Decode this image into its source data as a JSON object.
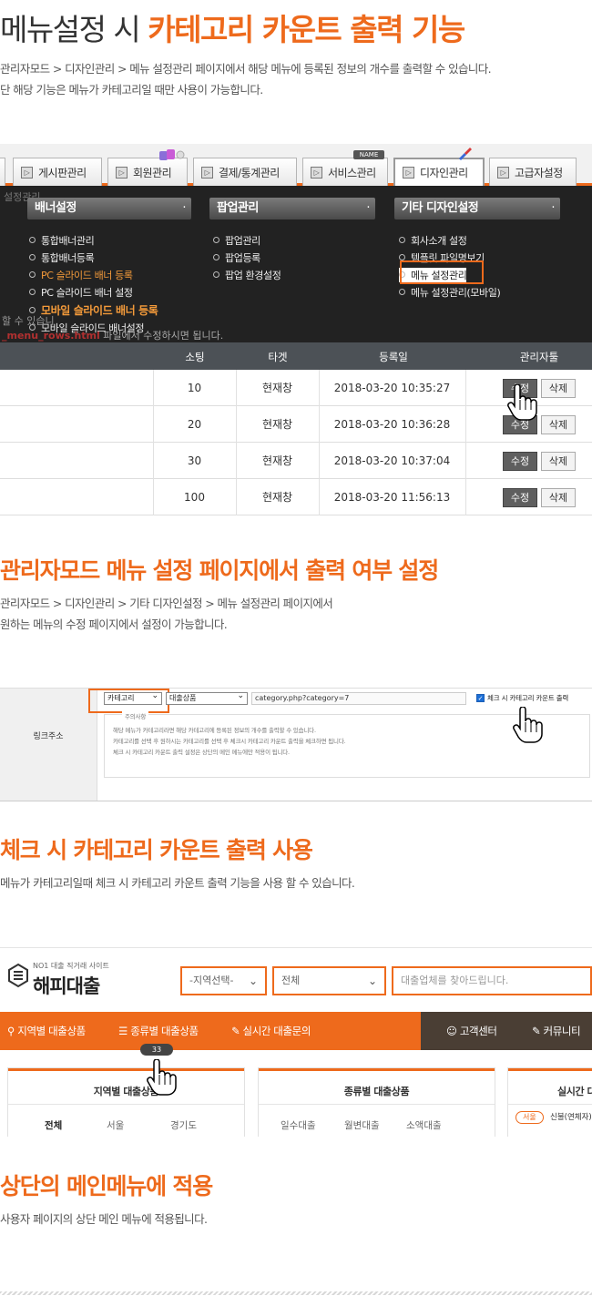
{
  "title": {
    "prefix": "메뉴설정 시 ",
    "highlight": "카테고리 카운트 출력 기능"
  },
  "intro": {
    "line1": "관리자모드 > 디자인관리 > 메뉴 설정관리 페이지에서 해당 메뉴에 등록된 정보의 개수를 출력할 수 있습니다.",
    "line2": "단 해당 기능은 메뉴가 카테고리일 때만 사용이 가능합니다."
  },
  "admin": {
    "tabs": [
      {
        "label": "게시판관리",
        "active": false
      },
      {
        "label": "회원관리",
        "active": false
      },
      {
        "label": "결제/통계관리",
        "active": false
      },
      {
        "label": "서비스관리",
        "active": false
      },
      {
        "label": "디자인관리",
        "active": true
      },
      {
        "label": "고급자설정",
        "active": false
      }
    ],
    "tab_badge": "NAME",
    "groups": [
      {
        "title": "배너설정",
        "dot": "·",
        "items": [
          "통합배너관리",
          "통합배너등록",
          "PC 슬라이드 배너 등록",
          "PC 슬라이드 배너 설정",
          "모바일 슬라이드 배너 등록",
          "모바일 슬라이드 배너설정"
        ]
      },
      {
        "title": "팝업관리",
        "dot": "·",
        "items": [
          "팝업관리",
          "팝업등록",
          "팝업 환경설정"
        ]
      },
      {
        "title": "기타 디자인설정",
        "dot": "·",
        "items": [
          "회사소개 설정",
          "템플릿 파일명보기",
          "메뉴 설정관리",
          "메뉴 설정관리(모바일)"
        ]
      }
    ],
    "ghost_left_top": "설정관리",
    "ghost_bottom_a": "할 수 있습니",
    "ghost_bottom_file": "_menu_rows.html",
    "ghost_bottom_b": " 파일에서 수정하시면 됩니다.",
    "table_headers": [
      "소팅",
      "타겟",
      "등록일",
      "관리자툴"
    ],
    "rows": [
      {
        "sort": "10",
        "target": "현재창",
        "date": "2018-03-20 10:35:27"
      },
      {
        "sort": "20",
        "target": "현재창",
        "date": "2018-03-20 10:36:28"
      },
      {
        "sort": "30",
        "target": "현재창",
        "date": "2018-03-20 10:37:04"
      },
      {
        "sort": "100",
        "target": "현재창",
        "date": "2018-03-20 11:56:13"
      }
    ],
    "edit_label": "수정",
    "delete_label": "삭제"
  },
  "section2": {
    "title": "관리자모드  메뉴 설정 페이지에서 출력 여부 설정",
    "line1": "관리자모드 > 디자인관리 > 기타 디자인설정 > 메뉴 설정관리 페이지에서",
    "line2": "원하는 메뉴의 수정 페이지에서 설정이 가능합니다."
  },
  "link_setting": {
    "label": "링크주소",
    "select1": "카테고리",
    "select2": "대출상품",
    "url_value": "category.php?category=7",
    "checkbox_label": "체크 시 카테고리 카운트 출력",
    "help_title": "주의사항",
    "help_lines": [
      "해당 메뉴가 카테고리라면 해당 카테고리에 등록된 정보의 개수를 출력할 수 있습니다.",
      "카테고리를 선택 후 원하시는 카테고리를 선택 후 체크시 카테고리 카운트 출력을 체크하면 됩니다.",
      "체크 시 카테고리 카운트 출력 설정은 상단의 메인 메뉴에만 적용이 됩니다."
    ]
  },
  "section3": {
    "title": "체크 시 카테고리 카운트 출력 사용",
    "line1": "메뉴가 카테고리일때 체크 시 카테고리 카운트 출력 기능을 사용 할 수 있습니다."
  },
  "front": {
    "logo_small": "NO1 대출 직거래 사이트",
    "logo_main": "해피대출",
    "region_select": "-지역선택-",
    "type_select": "전체",
    "search_placeholder": "대출업체를 찾아드립니다.",
    "nav": [
      "지역별 대출상품",
      "종류별 대출상품",
      "실시간 대출문의"
    ],
    "nav_right": [
      "고객센터",
      "커뮤니티"
    ],
    "count_badge": "33",
    "panels": [
      {
        "title": "지역별 대출상품",
        "tabs": [
          "전체",
          "서울",
          "경기도"
        ]
      },
      {
        "title": "종류별 대출상품",
        "tabs": [
          "일수대출",
          "월변대출",
          "소액대출"
        ]
      },
      {
        "title": "실시간 대",
        "tabs": []
      }
    ],
    "live_tag": "서울",
    "live_text": "신불(연체자)"
  },
  "section4": {
    "title": "상단의 메인메뉴에 적용",
    "line1": "사용자 페이지의 상단 메인 메뉴에 적용됩니다."
  }
}
